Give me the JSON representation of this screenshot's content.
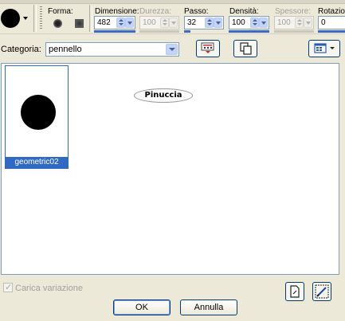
{
  "toolbar": {
    "forma": {
      "label": "Forma:"
    },
    "dimensione": {
      "label": "Dimensione:",
      "value": "482"
    },
    "durezza": {
      "label": "Durezza:",
      "value": "100",
      "disabled": true
    },
    "passo": {
      "label": "Passo:",
      "value": "32"
    },
    "densita": {
      "label": "Densità:",
      "value": "100"
    },
    "spessore": {
      "label": "Spessore:",
      "value": "100",
      "disabled": true
    },
    "rotazione": {
      "label": "Rotazion",
      "value": "0"
    }
  },
  "category": {
    "label": "Categoria:",
    "value": "pennello"
  },
  "brushes": [
    {
      "name": "geometric02",
      "selected": true
    }
  ],
  "watermark": "Pinuccia",
  "footer": {
    "checkbox_label": "Carica variazione",
    "ok": "OK",
    "cancel": "Annulla"
  },
  "colors": {
    "selection": "#316ac5",
    "field_border": "#7f9db9",
    "window_bg": "#ece9d8"
  }
}
